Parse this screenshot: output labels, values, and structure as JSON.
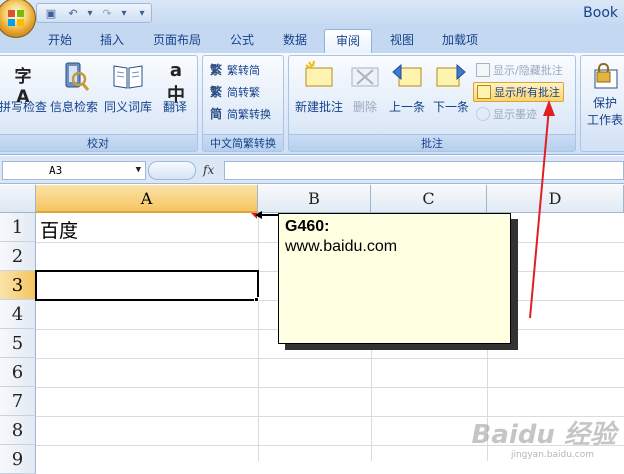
{
  "window": {
    "title": "Book"
  },
  "colors": {
    "ribbon_accent": "#15428b",
    "selected_header": "#f6c461",
    "comment_bg": "#ffffe1",
    "arrow": "#e02020"
  },
  "quick_access": [
    {
      "name": "save-icon",
      "glyph": "▣"
    },
    {
      "name": "undo-icon",
      "glyph": "↶"
    },
    {
      "name": "undo-dropdown-icon",
      "glyph": "▾"
    },
    {
      "name": "redo-icon",
      "glyph": "↷"
    },
    {
      "name": "redo-dropdown-icon",
      "glyph": "▾"
    },
    {
      "name": "customize-qat-icon",
      "glyph": "▾"
    }
  ],
  "tabs": [
    {
      "label": "开始"
    },
    {
      "label": "插入"
    },
    {
      "label": "页面布局"
    },
    {
      "label": "公式"
    },
    {
      "label": "数据"
    },
    {
      "label": "审阅",
      "active": true
    },
    {
      "label": "视图"
    },
    {
      "label": "加载项"
    }
  ],
  "ribbon": {
    "proofing": {
      "label": "校对",
      "spell_check": "拼写检查",
      "research": "信息检索",
      "thesaurus": "同义词库",
      "translate": "翻译",
      "spell_icon_text": "字A",
      "translate_icon_text": "a中"
    },
    "chinese_conversion": {
      "label": "中文简繁转换",
      "to_traditional": "繁转简",
      "to_simplified": "简转繁",
      "convert": "简繁转换",
      "icon_fan": "繁",
      "icon_jian": "简"
    },
    "comments": {
      "label": "批注",
      "new": "新建批注",
      "delete": "删除",
      "previous": "上一条",
      "next": "下一条",
      "show_hide": "显示/隐藏批注",
      "show_all": "显示所有批注",
      "show_ink": "显示墨迹"
    },
    "protect": {
      "label": "保护",
      "label2": "工作表"
    }
  },
  "formula_bar": {
    "name_box": "A3",
    "fx": "fx",
    "formula": ""
  },
  "sheet": {
    "columns": [
      "A",
      "B",
      "C",
      "D"
    ],
    "rows": [
      "1",
      "2",
      "3",
      "4",
      "5",
      "6",
      "7",
      "8",
      "9"
    ],
    "cells": {
      "A1": "百度"
    },
    "active_cell": "A3",
    "selected_column": "A",
    "selected_row": "3"
  },
  "comment": {
    "author": "G460:",
    "text": "www.baidu.com"
  },
  "watermark": {
    "text": "Baidu 经验",
    "sub": "jingyan.baidu.com"
  }
}
